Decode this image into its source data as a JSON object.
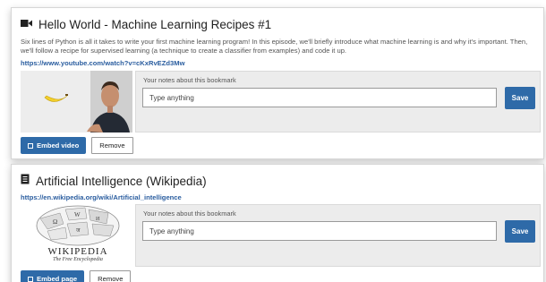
{
  "bookmarks": [
    {
      "title": "Hello World - Machine Learning Recipes #1",
      "icon": "video-camera-icon",
      "description": "Six lines of Python is all it takes to write your first machine learning program! In this episode, we'll briefly introduce what machine learning is and why it's important. Then, we'll follow a recipe for supervised learning (a technique to create a classifier from examples) and code it up.",
      "url": "https://www.youtube.com/watch?v=cKxRvEZd3Mw",
      "notes_label": "Your notes about this bookmark",
      "notes_placeholder": "Type anything",
      "save_label": "Save",
      "embed_label": "Embed video",
      "remove_label": "Remove"
    },
    {
      "title": "Artificial Intelligence (Wikipedia)",
      "icon": "document-icon",
      "url": "https://en.wikipedia.org/wiki/Artificial_intelligence",
      "notes_label": "Your notes about this bookmark",
      "notes_placeholder": "Type anything",
      "save_label": "Save",
      "embed_label": "Embed page",
      "remove_label": "Remove",
      "logo_wordmark": "WIKIPEDIA",
      "logo_tagline": "The Free Encyclopedia"
    }
  ],
  "colors": {
    "accent": "#2e6aa8",
    "link": "#2a5d9f"
  }
}
